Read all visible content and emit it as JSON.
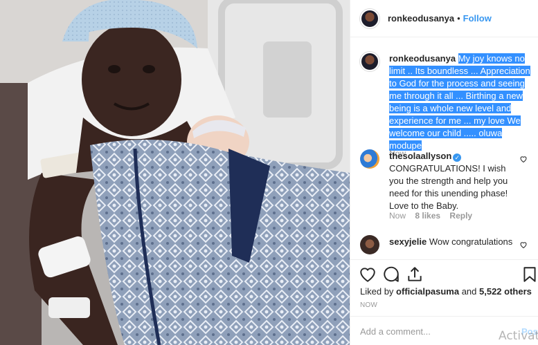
{
  "post": {
    "username": "ronkeodusanya",
    "separator": "•",
    "follow_label": "Follow"
  },
  "caption": {
    "username": "ronkeodusanya",
    "text": "My joy knows no limit .. Its boundless ... Appreciation to God for the process and seeing me through it all ... Birthing a new being is a whole new level and experience for me ... my love We welcome our child ..... oluwa modupe",
    "time": "Now"
  },
  "comments": [
    {
      "username": "thesolaallyson",
      "verified_mark": "✓",
      "text": "CONGRATULATIONS! I wish you the strength and help you need for this unending phase! Love to the Baby.",
      "time": "Now",
      "likes": "8 likes",
      "reply": "Reply"
    },
    {
      "username": "sexyjelie",
      "text": "Wow congratulations"
    }
  ],
  "actions": {
    "like_icon": "heart-icon",
    "comment_icon": "comment-icon",
    "share_icon": "share-icon",
    "save_icon": "bookmark-icon"
  },
  "likes": {
    "prefix": "Liked by ",
    "user": "officialpasuma",
    "middle": " and ",
    "count": "5,522 others"
  },
  "post_time": "NOW",
  "add_comment": {
    "placeholder": "Add a comment...",
    "post_label": "Post"
  },
  "watermark": "Activate",
  "colors": {
    "link": "#3897f0",
    "highlight": "#3390ff",
    "muted": "#999999"
  }
}
